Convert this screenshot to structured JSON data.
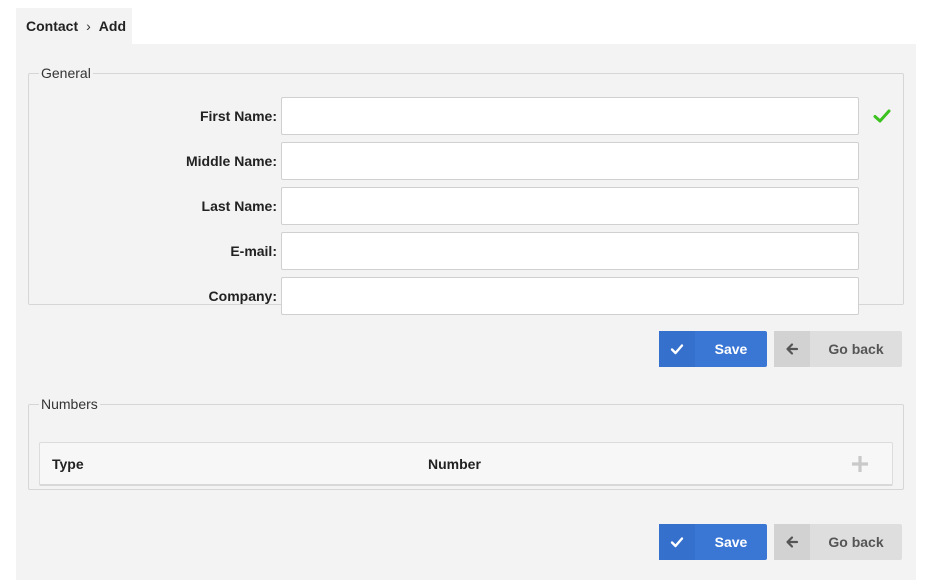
{
  "breadcrumb": {
    "root": "Contact",
    "separator": "›",
    "current": "Add"
  },
  "general": {
    "legend": "General",
    "fields": {
      "first_name": {
        "label": "First Name:",
        "value": "",
        "placeholder": ""
      },
      "middle_name": {
        "label": "Middle Name:",
        "value": "",
        "placeholder": ""
      },
      "last_name": {
        "label": "Last Name:",
        "value": "",
        "placeholder": ""
      },
      "email": {
        "label": "E-mail:",
        "value": "",
        "placeholder": ""
      },
      "company": {
        "label": "Company:",
        "value": "",
        "placeholder": ""
      }
    },
    "valid_icon": "check-icon"
  },
  "actions": {
    "save_label": "Save",
    "back_label": "Go back"
  },
  "numbers": {
    "legend": "Numbers",
    "columns": [
      "Type",
      "Number"
    ],
    "add_icon": "plus-icon"
  },
  "colors": {
    "primary": "#3a77d4",
    "secondary": "#dedede",
    "success": "#3cc21e",
    "panel_bg": "#f3f3f3"
  }
}
